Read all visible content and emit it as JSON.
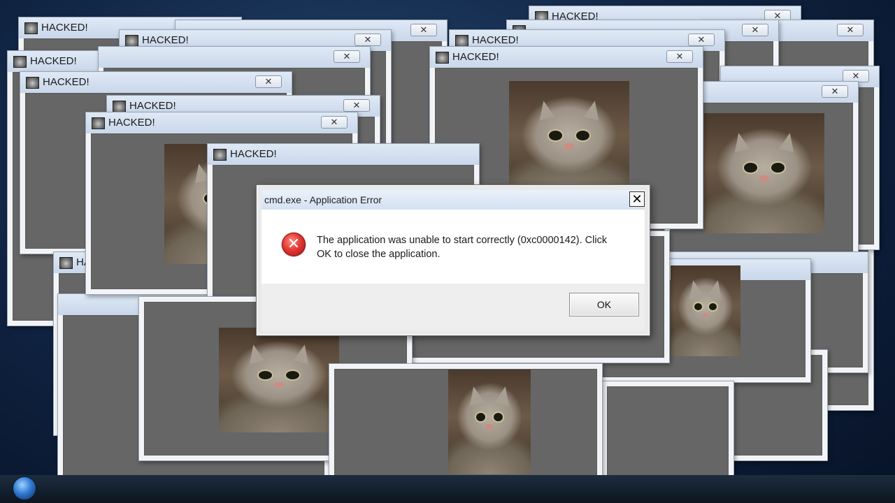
{
  "popup": {
    "title": "HACKED!",
    "close_glyph": "✕",
    "icon": "cat-icon",
    "image": "cat-photo"
  },
  "dialog": {
    "title": "cmd.exe - Application Error",
    "close_glyph": "✕",
    "icon": "error-icon",
    "icon_glyph": "✕",
    "message": "The application was unable to start correctly (0xc0000142). Click OK to close the application.",
    "ok_label": "OK"
  },
  "colors": {
    "popup_content_bg": "#666666",
    "titlebar": "#d4e1f1",
    "error_red": "#e53935"
  }
}
